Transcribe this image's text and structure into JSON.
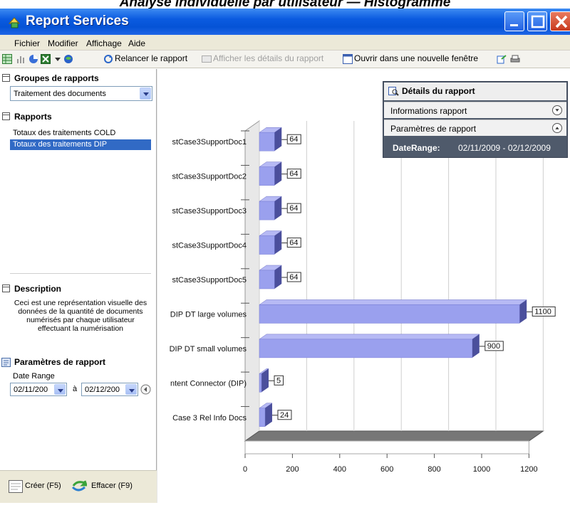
{
  "caption": "Analyse individuelle par utilisateur — Histogramme",
  "window": {
    "title": "Report Services"
  },
  "menu": [
    "Fichier",
    "Modifier",
    "Affichage",
    "Aide"
  ],
  "toolbar": {
    "rerun": "Relancer le rapport",
    "details": "Afficher les détails du rapport",
    "open_new": "Ouvrir dans une nouvelle fenêtre"
  },
  "left": {
    "groups_header": "Groupes de rapports",
    "group_selected": "Traitement des documents",
    "reports_header": "Rapports",
    "reports": [
      "Totaux des traitements COLD",
      "Totaux des traitements DIP"
    ],
    "description_header": "Description",
    "description": "Ceci est une représentation visuelle des données de la quantité de documents numérisés par chaque utilisateur effectuant la numérisation",
    "params_header": "Paramètres de rapport",
    "date_range_label": "Date Range",
    "date_from": "02/11/200",
    "date_sep": "à",
    "date_to": "02/12/200",
    "create_label": "Créer (F5)",
    "clear_label": "Effacer (F9)"
  },
  "details": {
    "header": "Détails du rapport",
    "info": "Informations rapport",
    "params": "Paramètres de rapport",
    "range_label": "DateRange:",
    "range_value": "02/11/2009 - 02/12/2009"
  },
  "colors": {
    "bar_face": "#9aa0ee",
    "bar_top": "#b6b9f4",
    "bar_side": "#4b4f9c"
  },
  "chart_data": {
    "type": "bar",
    "orientation": "horizontal",
    "categories": [
      "stCase3SupportDoc1",
      "stCase3SupportDoc2",
      "stCase3SupportDoc3",
      "stCase3SupportDoc4",
      "stCase3SupportDoc5",
      "DIP DT large volumes",
      "DIP DT small volumes",
      "ntent Connector (DIP)",
      "Case 3 Rel Info Docs"
    ],
    "values": [
      64,
      64,
      64,
      64,
      64,
      1100,
      900,
      5,
      24
    ],
    "xlim": [
      0,
      1200
    ],
    "xticks": [
      0,
      200,
      400,
      600,
      800,
      1000,
      1200
    ],
    "grid": true
  }
}
